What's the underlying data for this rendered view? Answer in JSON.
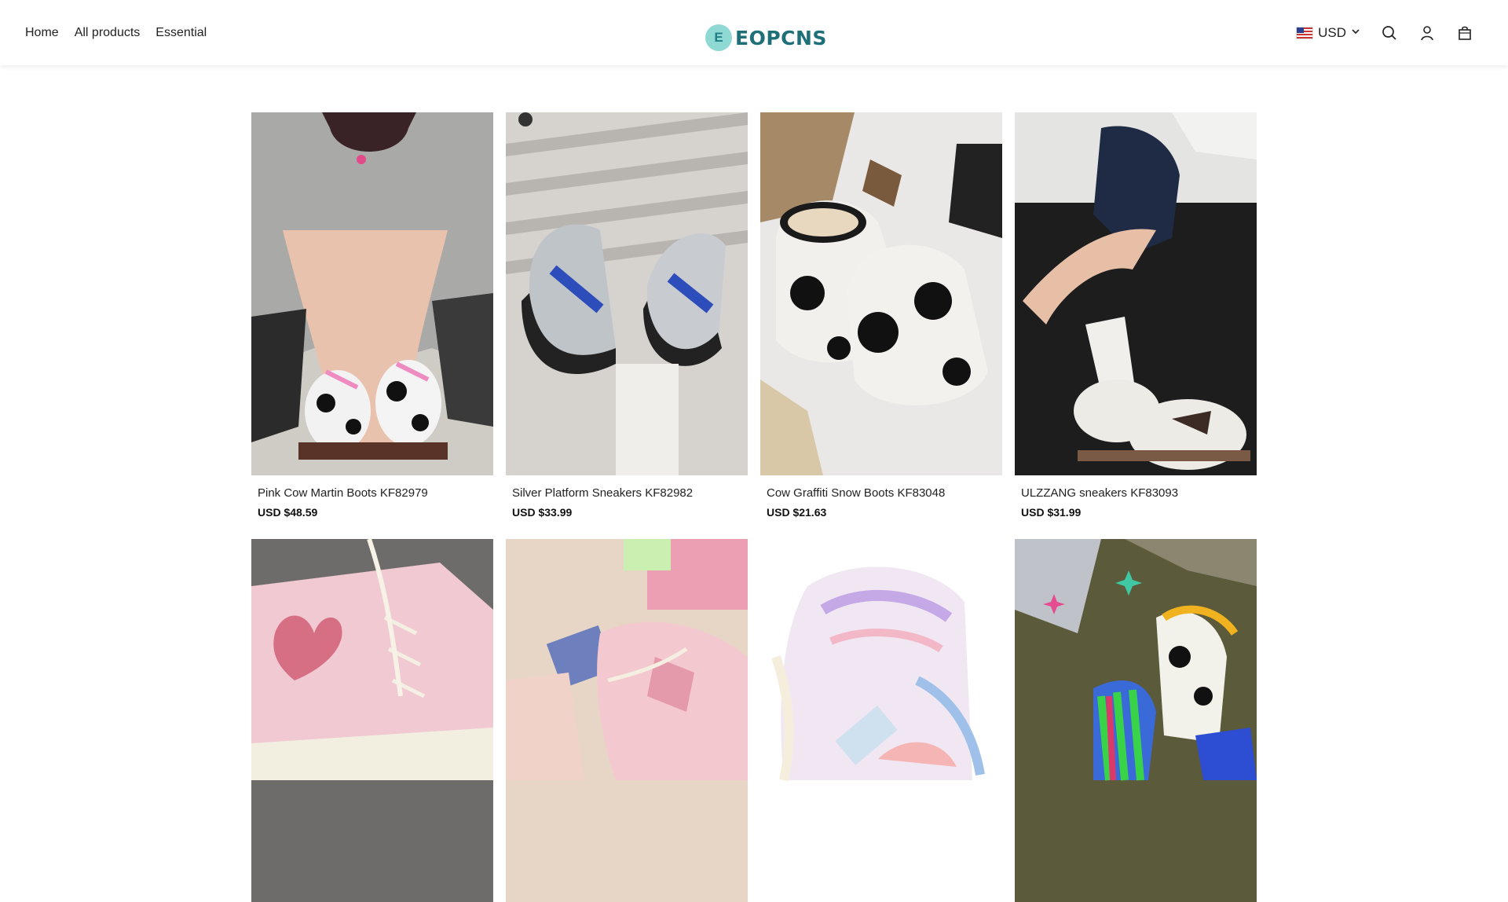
{
  "nav": {
    "items": [
      {
        "id": "home",
        "label": "Home"
      },
      {
        "id": "all-products",
        "label": "All products"
      },
      {
        "id": "essential",
        "label": "Essential"
      }
    ]
  },
  "brand": {
    "badge": "E",
    "name": "EOPCNS"
  },
  "tools": {
    "currency": "USD",
    "icons": [
      "search-icon",
      "account-icon",
      "cart-icon"
    ]
  },
  "products": [
    {
      "title": "Pink Cow Martin Boots KF82979",
      "price": "USD $48.59"
    },
    {
      "title": "Silver Platform Sneakers KF82982",
      "price": "USD $33.99"
    },
    {
      "title": "Cow Graffiti Snow Boots KF83048",
      "price": "USD $21.63"
    },
    {
      "title": "ULZZANG sneakers KF83093",
      "price": "USD $31.99"
    },
    {
      "title": "",
      "price": ""
    },
    {
      "title": "",
      "price": ""
    },
    {
      "title": "",
      "price": ""
    },
    {
      "title": "",
      "price": ""
    }
  ],
  "colors": {
    "brand": "#1f6f78",
    "brand_badge": "#8fd9d5",
    "text": "#222222"
  }
}
